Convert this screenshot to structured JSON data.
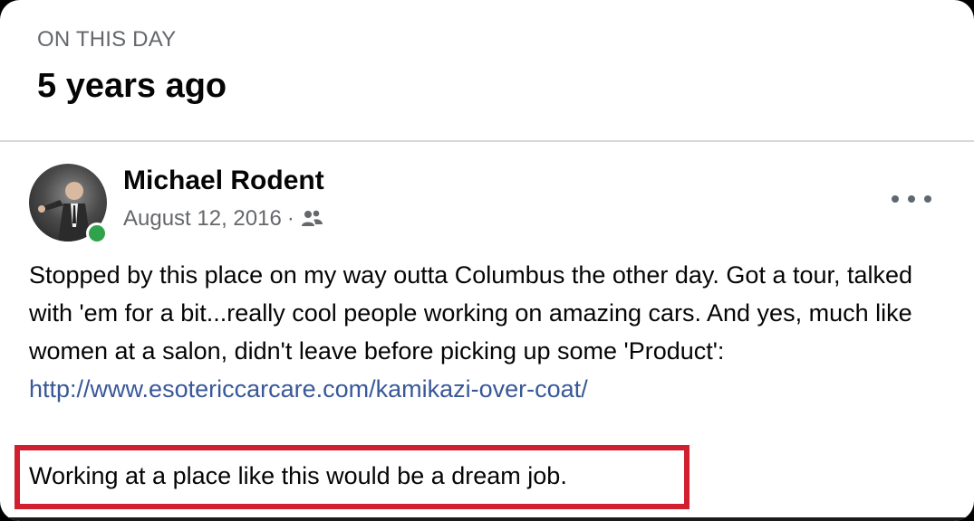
{
  "header": {
    "eyebrow": "ON THIS DAY",
    "headline": "5 years ago"
  },
  "post": {
    "author": "Michael Rodent",
    "date": "August 12, 2016",
    "date_separator": "·",
    "audience_icon": "friends-icon",
    "online_status_color": "#31a24c",
    "more_icon": "more-horizontal-icon",
    "body_text": "Stopped by this place on my way outta Columbus the other day. Got a tour, talked with 'em for a bit...really cool people working on amazing cars. And yes, much like women at a salon, didn't leave before picking up some 'Product': ",
    "link_text": "http://www.esotericcarcare.com/kamikazi-over-coat/",
    "highlighted_text": "Working at a place like this would be a dream job."
  },
  "colors": {
    "highlight_border": "#d0202f",
    "link": "#385898",
    "secondary_text": "#65676b"
  }
}
